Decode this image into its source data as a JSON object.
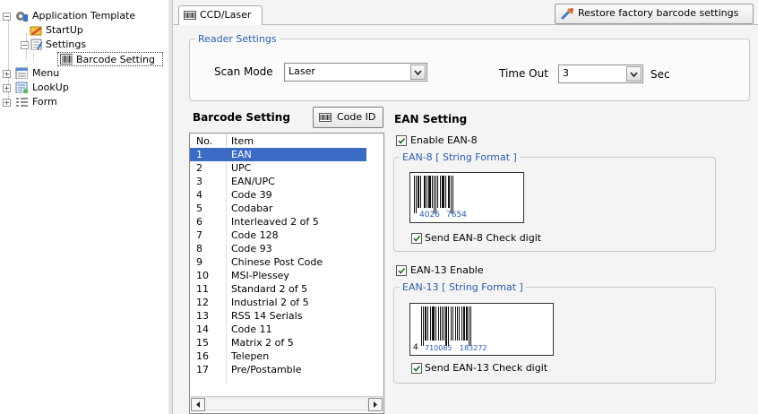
{
  "tree": {
    "items": [
      {
        "label": "Application Template"
      },
      {
        "label": "StartUp"
      },
      {
        "label": "Settings"
      },
      {
        "label": "Barcode Setting"
      },
      {
        "label": "Menu"
      },
      {
        "label": "LookUp"
      },
      {
        "label": "Form"
      }
    ]
  },
  "tab": {
    "label": "CCD/Laser"
  },
  "toolbar": {
    "restore_label": "Restore factory barcode settings"
  },
  "reader": {
    "legend": "Reader Settings",
    "scan_mode_label": "Scan Mode",
    "scan_mode_value": "Laser",
    "timeout_label": "Time Out",
    "timeout_value": "3",
    "timeout_unit": "Sec"
  },
  "barcode": {
    "title": "Barcode Setting",
    "code_id_button": "Code ID",
    "columns": [
      "No.",
      "Item"
    ],
    "rows": [
      {
        "no": "1",
        "item": "EAN"
      },
      {
        "no": "2",
        "item": "UPC"
      },
      {
        "no": "3",
        "item": "EAN/UPC"
      },
      {
        "no": "4",
        "item": "Code 39"
      },
      {
        "no": "5",
        "item": "Codabar"
      },
      {
        "no": "6",
        "item": "Interleaved 2 of 5"
      },
      {
        "no": "7",
        "item": "Code 128"
      },
      {
        "no": "8",
        "item": "Code 93"
      },
      {
        "no": "9",
        "item": "Chinese Post Code"
      },
      {
        "no": "10",
        "item": "MSI-Plessey"
      },
      {
        "no": "11",
        "item": "Standard  2 of 5"
      },
      {
        "no": "12",
        "item": "Industrial  2 of 5"
      },
      {
        "no": "13",
        "item": "RSS 14 Serials"
      },
      {
        "no": "14",
        "item": "Code 11"
      },
      {
        "no": "15",
        "item": "Matrix 2 of 5"
      },
      {
        "no": "16",
        "item": "Telepen"
      },
      {
        "no": "17",
        "item": "Pre/Postamble"
      }
    ],
    "selected": "1"
  },
  "ean": {
    "title": "EAN Setting",
    "enable_ean8": "Enable EAN-8",
    "ean8_legend": "EAN-8 [ String Format ]",
    "ean8_digits_left": "4026",
    "ean8_digits_right": "7654",
    "send_ean8_check": "Send EAN-8 Check digit",
    "enable_ean13": "EAN-13 Enable",
    "ean13_legend": "EAN-13 [ String Format ]",
    "ean13_digit_first": "4",
    "ean13_digits_left": "710085",
    "ean13_digits_right": "183272",
    "send_ean13_check": "Send EAN-13 Check digit"
  },
  "colors": {
    "accent": "#2a5db0",
    "selection": "#3c6bc6"
  }
}
